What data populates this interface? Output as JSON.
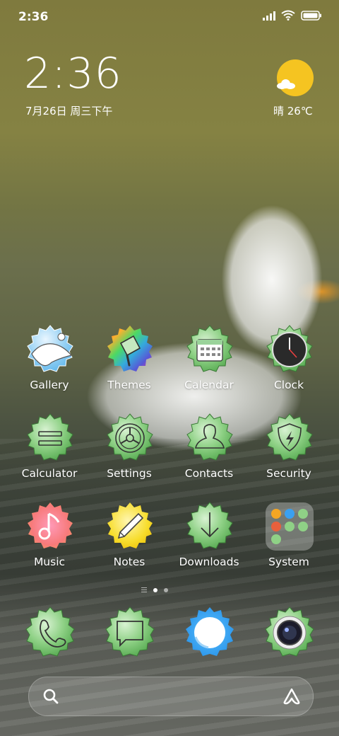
{
  "status_bar": {
    "time": "2:36"
  },
  "clock_widget": {
    "time": "2:36",
    "date": "7月26日 周三下午",
    "weather": "晴 26℃",
    "weather_icon": "sunny-cloud-icon"
  },
  "apps": [
    {
      "id": "gallery",
      "label": "Gallery",
      "icon": "gallery-icon"
    },
    {
      "id": "themes",
      "label": "Themes",
      "icon": "themes-icon"
    },
    {
      "id": "calendar",
      "label": "Calendar",
      "icon": "calendar-icon"
    },
    {
      "id": "clock",
      "label": "Clock",
      "icon": "clock-icon"
    },
    {
      "id": "calculator",
      "label": "Calculator",
      "icon": "calculator-icon"
    },
    {
      "id": "settings",
      "label": "Settings",
      "icon": "settings-icon"
    },
    {
      "id": "contacts",
      "label": "Contacts",
      "icon": "contacts-icon"
    },
    {
      "id": "security",
      "label": "Security",
      "icon": "shield-icon"
    },
    {
      "id": "music",
      "label": "Music",
      "icon": "music-note-icon"
    },
    {
      "id": "notes",
      "label": "Notes",
      "icon": "pencil-icon"
    },
    {
      "id": "downloads",
      "label": "Downloads",
      "icon": "download-arrow-icon"
    },
    {
      "id": "system",
      "label": "System",
      "icon": "folder-icon"
    }
  ],
  "dock": [
    {
      "id": "phone",
      "icon": "phone-icon"
    },
    {
      "id": "messages",
      "icon": "message-icon"
    },
    {
      "id": "browser",
      "icon": "browser-icon"
    },
    {
      "id": "camera",
      "icon": "camera-icon"
    }
  ],
  "pager": {
    "pages": 2,
    "active": 1
  },
  "colors": {
    "badge_green": "#7cc576",
    "badge_yellow": "#f7dd2c",
    "badge_blue": "#2f9cf0",
    "sun_yellow": "#f5c421"
  }
}
